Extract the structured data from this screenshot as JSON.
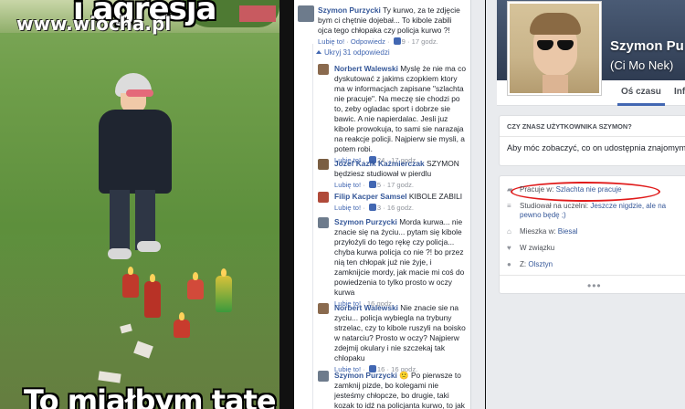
{
  "photo": {
    "caption_top": "i agresja",
    "watermark": "www.wiocha.pl",
    "caption_bottom": "To miałbym tatę"
  },
  "comments": {
    "top_comment": {
      "author": "Szymon Purzycki",
      "text": " Ty kurwo, za te zdjęcie bym ci chętnie dojebał... To kibole zabili ojca tego chłopaka czy policja kurwo ?!",
      "like": "Lubię to!",
      "reply": "Odpowiedz",
      "likes": "9",
      "time": "17 godz."
    },
    "replies_toggle": "Ukryj 31 odpowiedzi",
    "replies": [
      {
        "author": "Norbert Walewski",
        "text": " Myslę że nie ma co dyskutować z jakims czopkiem ktory ma w informacjach zapisane \"szlachta nie pracuje\". Na meczę sie chodzi po to, zeby ogladac sport i dobrze sie bawic. A nie napierdalac. Jesli juz kibole prowokuja, to sami sie narazaja na reakcje policji. Najpierw sie mysli, a potem robi.",
        "like": "Lubię to!",
        "likes": "24",
        "time": "17 godz."
      },
      {
        "author": "Józef Kazik Kaźmierczak",
        "text": " SZYMON będziesz studiował w pierdlu",
        "like": "Lubię to!",
        "likes": "5",
        "time": "17 godz."
      },
      {
        "author": "Filip Kacper Samsel",
        "text": " KIBOLE ZABILI",
        "like": "Lubię to!",
        "likes": "3",
        "time": "16 godz."
      },
      {
        "author": "Szymon Purzycki",
        "text": " Morda kurwa... nie znacie się na życiu... pytam się kibole przyłożyli do tego rękę czy policja... chyba kurwa policja co nie ?! bo przez nią ten chłopak już nie żyje, i zamknijcie mordy, jak macie mi coś do powiedzenia to tylko prosto w oczy kurwa",
        "like": "Lubię to!",
        "likes": "",
        "time": "16 godz."
      },
      {
        "author": "Norbert Walewski",
        "text": " Nie znacie sie na zyciu... policja wybiegla na trybuny strzelac, czy to kibole ruszyli na boisko w natarciu? Prosto w oczy? Najpierw zdejmij okulary i nie szczekaj tak chlopaku",
        "like": "Lubię to!",
        "likes": "16",
        "time": "16 godz."
      },
      {
        "author": "Szymon Purzycki",
        "text": " 🙁 Po pierwsze to zamknij pizde, bo kolegami nie jesteśmy chłopcze, bo drugie, taki kozak to idź na policjanta kurwo, to jak przyjedziesz do",
        "like": "",
        "likes": "",
        "time": ""
      }
    ]
  },
  "profile": {
    "name": "Szymon Pu",
    "alt_name": "(Ci Mo Nek)",
    "tabs": [
      "Oś czasu",
      "Inf"
    ],
    "know_header": "CZY ZNASZ UŻYTKOWNIKA SZYMON?",
    "know_text": "Aby móc zobaczyć, co on udostępnia znajomym, w",
    "about": {
      "work_prefix": "Pracuje w: ",
      "work_value": "Szlachta nie pracuje",
      "school_prefix": "Studiował na uczelni: ",
      "school_value": "Jeszcze nigdzie, ale na pewno będę ;)",
      "lives_prefix": "Mieszka w: ",
      "lives_value": "Biesal",
      "relationship": "W związku",
      "from_prefix": "Z: ",
      "from_value": "Olsztyn"
    },
    "more": "•••"
  },
  "colors": {
    "fb_link": "#365899",
    "fb_blue": "#4267b2",
    "highlight_oval": "#e01a1a",
    "panel_bg": "#e9ebee"
  }
}
